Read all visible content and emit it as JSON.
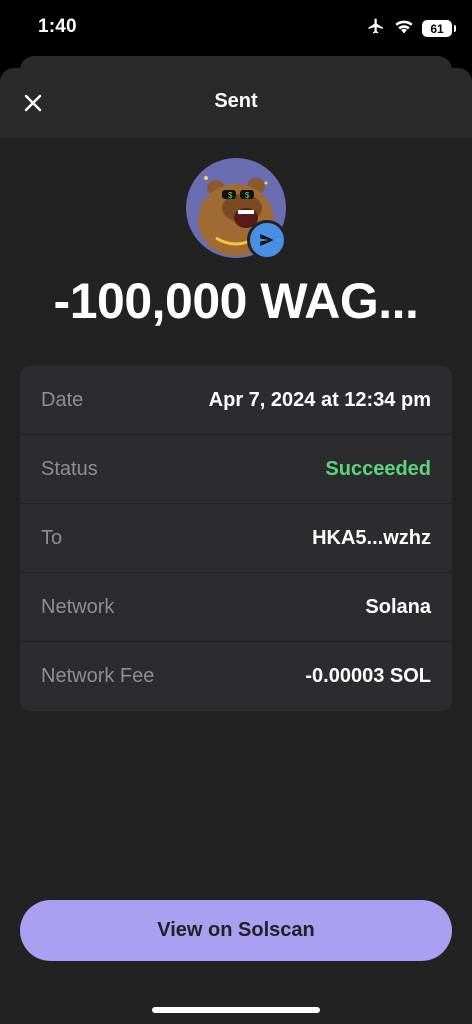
{
  "status_bar": {
    "time": "1:40",
    "battery": "61"
  },
  "header": {
    "title": "Sent"
  },
  "transaction": {
    "amount": "-100,000 WAG...",
    "send_color": "#4a90e2"
  },
  "details": [
    {
      "label": "Date",
      "value": "Apr 7, 2024 at 12:34 pm"
    },
    {
      "label": "Status",
      "value": "Succeeded"
    },
    {
      "label": "To",
      "value": "HKA5...wzhz"
    },
    {
      "label": "Network",
      "value": "Solana"
    },
    {
      "label": "Network Fee",
      "value": "-0.00003 SOL"
    }
  ],
  "colors": {
    "accent": "#ab9ff2",
    "success": "#5dd47b",
    "background": "#222222"
  },
  "actions": {
    "solscan_label": "View on Solscan"
  }
}
